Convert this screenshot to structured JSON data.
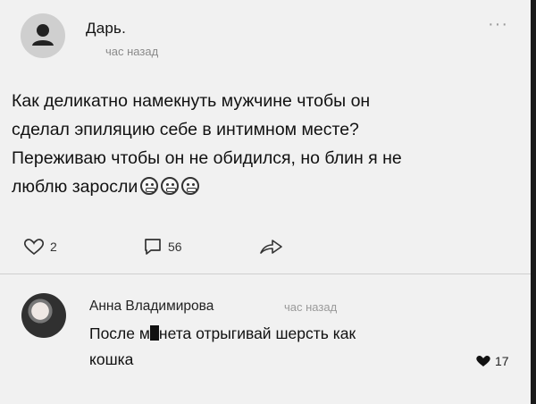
{
  "post": {
    "author": "Дарь.",
    "time": "час назад",
    "text_lines": [
      "Как деликатно намекнуть мужчине чтобы он",
      "сделал эпиляцию себе в интимном месте?",
      "Переживаю чтобы он не обидился, но блин я не",
      "люблю заросли"
    ],
    "more_label": "···",
    "likes": "2",
    "comments": "56"
  },
  "comment": {
    "author": "Анна Владимирова",
    "time": "час назад",
    "text_part1": "После м",
    "text_part2": "нета отрыгивай шерсть как",
    "text_line2": "кошка",
    "likes": "17"
  },
  "colors": {
    "background": "#f1f1f1",
    "text": "#111111",
    "muted": "#8a8a8a"
  },
  "icons": [
    "user-icon",
    "more-icon",
    "heart-icon",
    "comment-icon",
    "share-icon",
    "grimace-emoji-icon",
    "heart-filled-icon"
  ]
}
